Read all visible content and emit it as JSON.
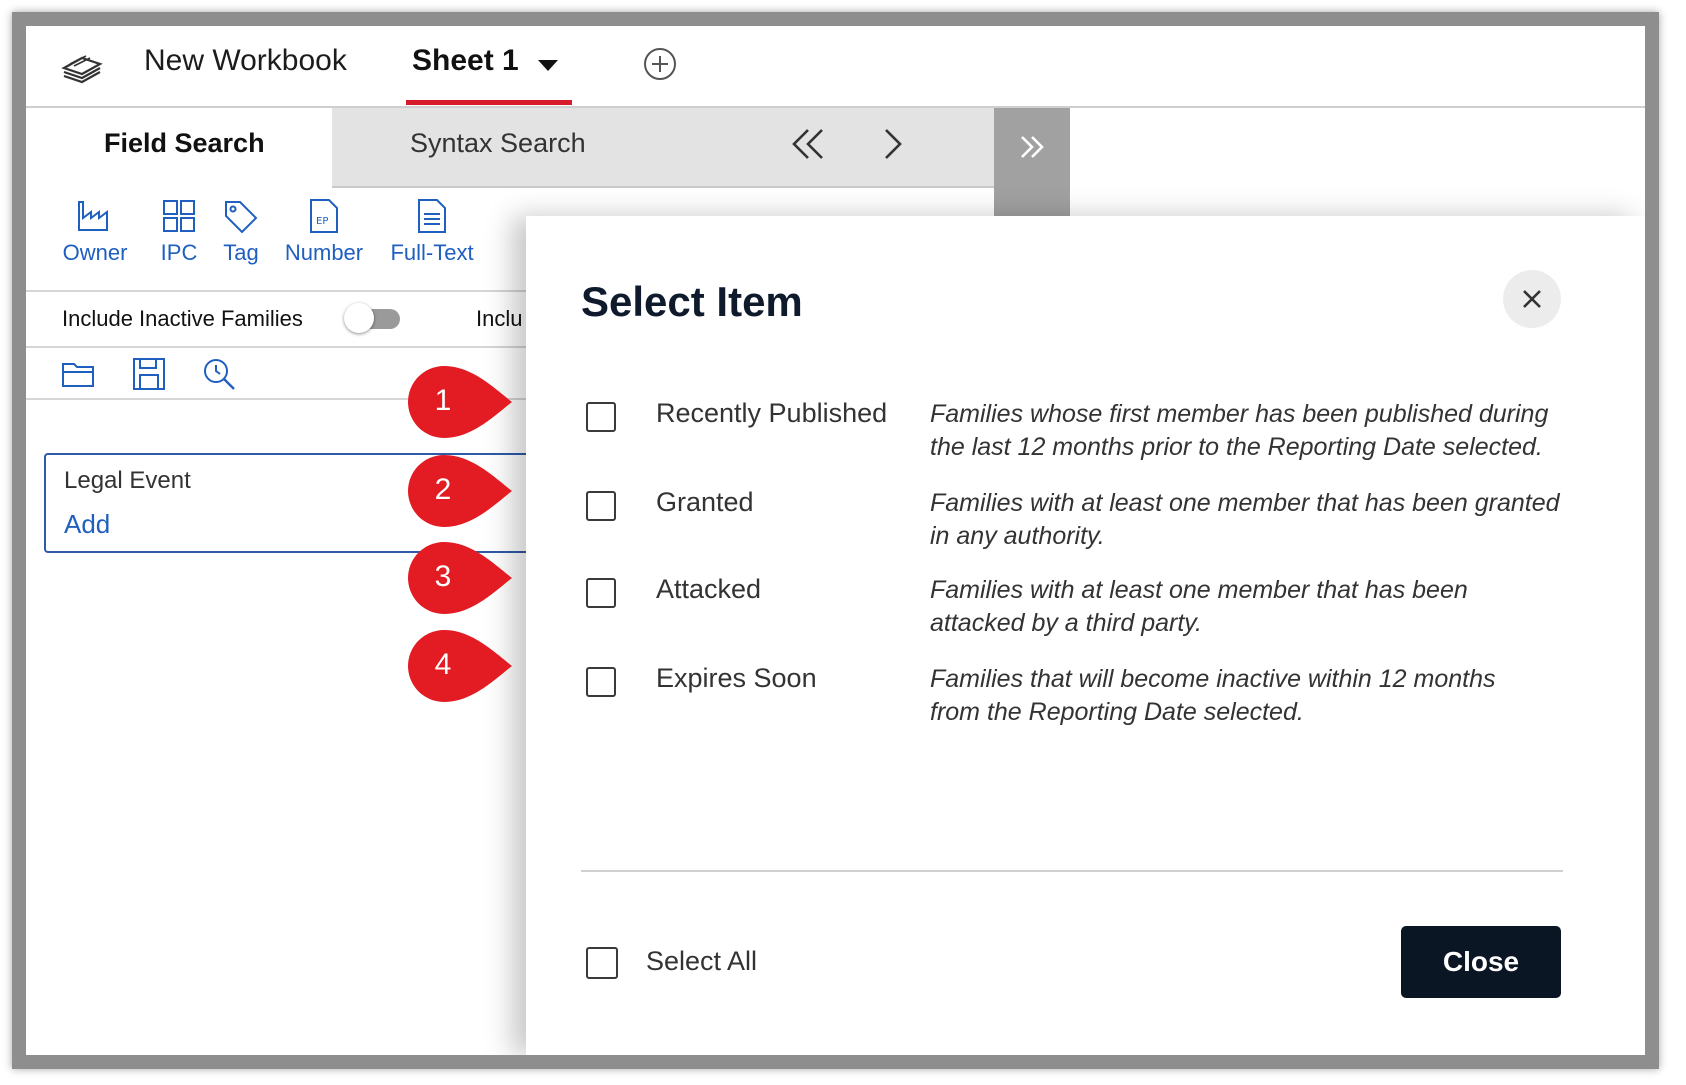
{
  "topbar": {
    "workbook_title": "New Workbook",
    "sheet_name": "Sheet 1"
  },
  "tabs": {
    "field_search": "Field Search",
    "syntax_search": "Syntax Search"
  },
  "toolbar": {
    "owner": "Owner",
    "ipc": "IPC",
    "tag": "Tag",
    "number": "Number",
    "full_text": "Full-Text"
  },
  "options": {
    "include_inactive": "Include Inactive Families",
    "include_partial": "Inclu",
    "include_inactive_on": false
  },
  "legal_event": {
    "title": "Legal Event",
    "add": "Add"
  },
  "modal": {
    "title": "Select Item",
    "items": [
      {
        "label": "Recently Published",
        "desc_line1": "Families whose first member has been published during",
        "desc_line2": "the last 12 months prior to the Reporting Date selected.",
        "checked": false
      },
      {
        "label": "Granted",
        "desc_line1": "Families with at least one member that has been granted",
        "desc_line2": "in any authority.",
        "checked": false
      },
      {
        "label": "Attacked",
        "desc_line1": "Families with at least one member that has been",
        "desc_line2": "attacked by a third party.",
        "checked": false
      },
      {
        "label": "Expires Soon",
        "desc_line1": "Families that will become inactive within 12 months",
        "desc_line2": "from the Reporting Date selected.",
        "checked": false
      }
    ],
    "select_all": "Select All",
    "close_button": "Close"
  },
  "callouts": [
    "1",
    "2",
    "3",
    "4"
  ],
  "colors": {
    "accent_blue": "#1f5fbf",
    "callout_red": "#e31b23",
    "tab_underline": "#d81b2a",
    "close_button_bg": "#0b1624"
  }
}
